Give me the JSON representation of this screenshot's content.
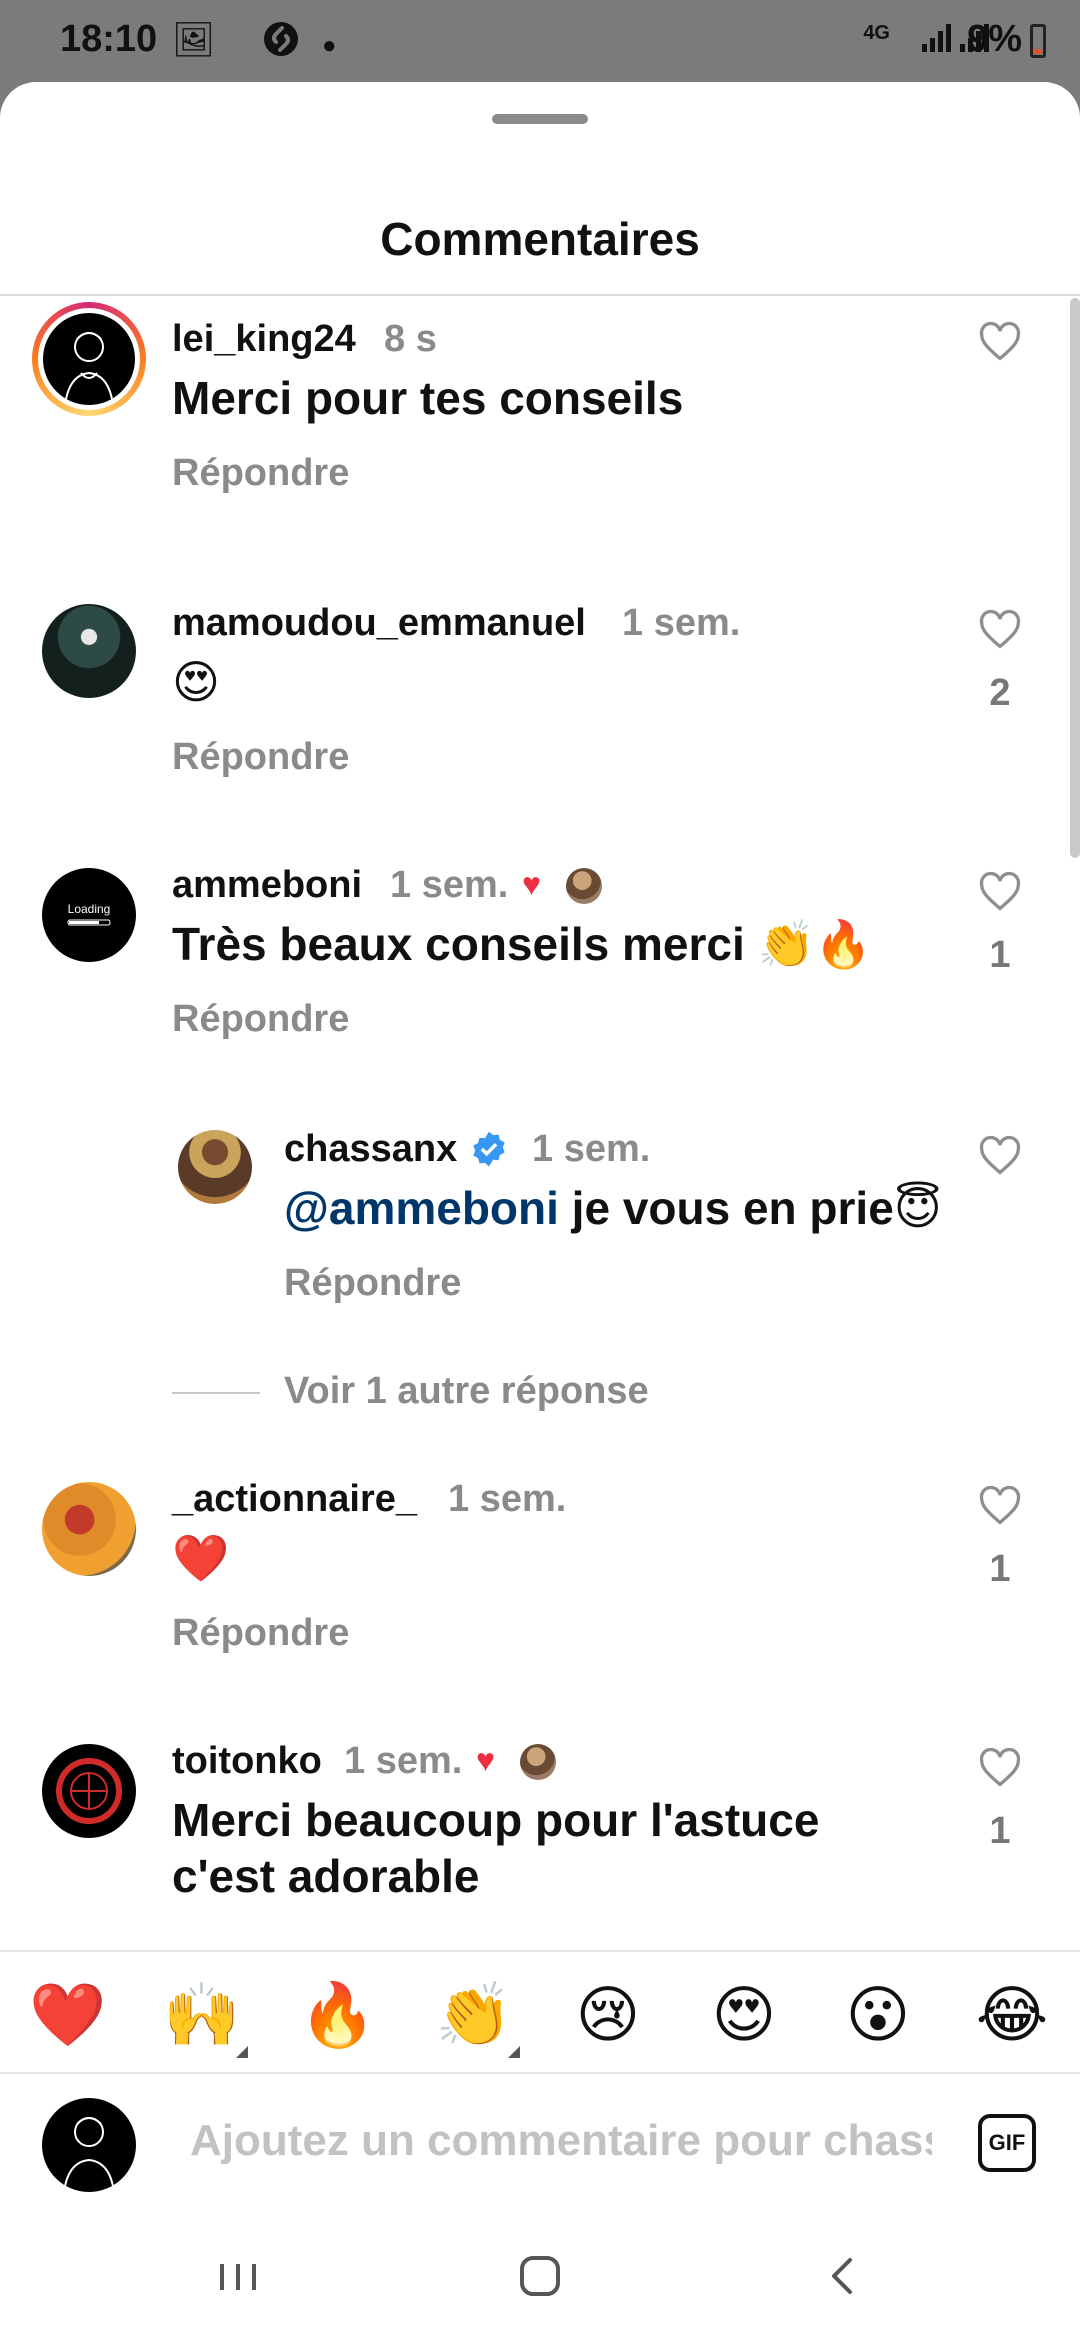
{
  "status_bar": {
    "time": "18:10",
    "network": "4G",
    "battery": "9%"
  },
  "sheet": {
    "title": "Commentaires"
  },
  "comments": [
    {
      "user": "lei_king24",
      "time": "8 s",
      "text": "Merci pour tes conseils",
      "reply": "Répondre",
      "likes": ""
    },
    {
      "user": "mamoudou_emmanuel",
      "time": "1 sem.",
      "text": "😍",
      "reply": "Répondre",
      "likes": "2"
    },
    {
      "user": "ammeboni",
      "time": "1 sem.",
      "text": "Très beaux conseils merci 👏🔥",
      "reply": "Répondre",
      "likes": "1"
    },
    {
      "user": "_actionnaire_",
      "time": "1 sem.",
      "text": "❤️",
      "reply": "Répondre",
      "likes": "1"
    },
    {
      "user": "toitonko",
      "time": "1 sem.",
      "text": "Merci beaucoup pour l'astuce c'est adorable",
      "reply": "",
      "likes": "1"
    }
  ],
  "reply_thread": {
    "user": "chassanx",
    "time": "1 sem.",
    "mention": "@ammeboni",
    "text": " je vous en prie😇",
    "reply": "Répondre",
    "view_more": "Voir 1 autre réponse"
  },
  "reactions": [
    "❤️",
    "🙌",
    "🔥",
    "👏",
    "😢",
    "😍",
    "😮",
    "😂"
  ],
  "composer": {
    "placeholder": "Ajoutez un commentaire pour chassanx...",
    "gif_label": "GIF"
  },
  "colors": {
    "accent_blue": "#00376b",
    "muted": "#8a8a8a",
    "like_red": "#ed2d42",
    "verified_blue": "#3897f0"
  }
}
